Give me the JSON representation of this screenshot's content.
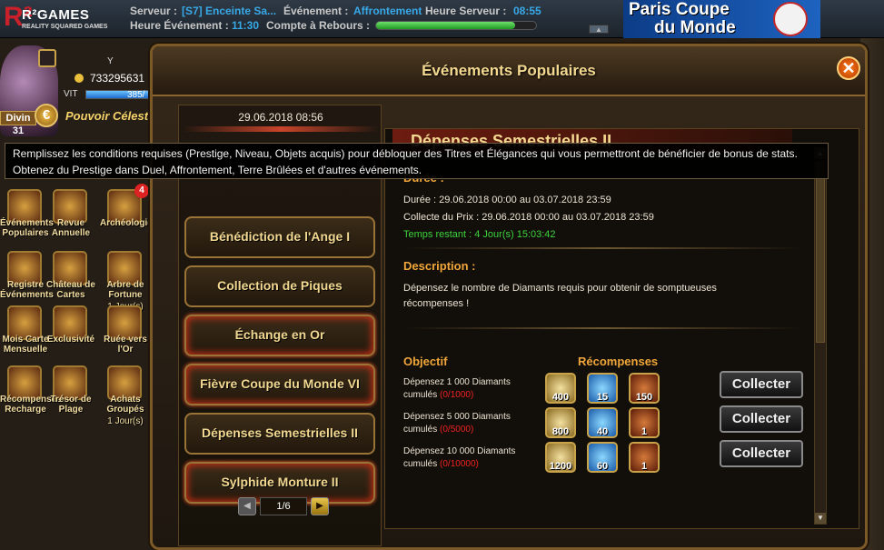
{
  "topbar": {
    "logo": {
      "mark": "R²",
      "name": "R²GAMES",
      "tagline": "REALITY SQUARED GAMES"
    },
    "server_label": "Serveur :",
    "server_value": "[S7] Enceinte Sa...",
    "event_label": "Événement :",
    "event_value": "Affrontement",
    "server_time_label": "Heure Serveur :",
    "server_time_value": "08:55",
    "event_time_label": "Heure Événement :",
    "event_time_value": "11:30",
    "countdown_label": "Compte à Rebours :",
    "countdown_progress": 0.87,
    "collapse_icon": "up-arrow-icon",
    "banner_line1": "Paris Coupe",
    "banner_line2": "du Monde"
  },
  "player": {
    "name": "Y",
    "gold": "733295631",
    "vit_label": "VIT",
    "vit_value": "385/",
    "vit_fill": 0.96,
    "rank_label": "Divin 31",
    "rank_icon_text": "€",
    "title": "Pouvoir Céleste"
  },
  "side_icons": [
    {
      "label": "Événements Populaires",
      "icon": "events-icon"
    },
    {
      "label": "Revue Annuelle",
      "icon": "annual-review-icon"
    },
    {
      "label": "Archéologie",
      "icon": "archeology-icon",
      "badge": "4"
    },
    {
      "label": "Registre Événements",
      "icon": "registry-icon"
    },
    {
      "label": "Château de Cartes",
      "icon": "card-castle-icon"
    },
    {
      "label": "Arbre de Fortune",
      "icon": "fortune-tree-icon",
      "note": "1 Jour(s)"
    },
    {
      "label": "Mois Carte Mensuelle",
      "icon": "monthly-card-icon"
    },
    {
      "label": "Exclusivité",
      "icon": "exclusive-icon"
    },
    {
      "label": "Ruée vers l'Or",
      "icon": "gold-rush-icon"
    },
    {
      "label": "Récompenses Recharge",
      "icon": "recharge-rewards-icon"
    },
    {
      "label": "Trésor de Plage",
      "icon": "beach-treasure-icon"
    },
    {
      "label": "Achats Groupés",
      "icon": "group-buy-icon",
      "note": "1 Jour(s)"
    }
  ],
  "modal": {
    "title": "Événements Populaires",
    "close_icon": "close-icon",
    "left": {
      "date": "29.06.2018 08:56",
      "events": [
        "Bénédiction de l'Ange I",
        "Collection de Piques",
        "Échange en Or",
        "Fièvre Coupe du Monde VI",
        "Dépenses Semestrielles II",
        "Sylphide Monture II"
      ],
      "pager": {
        "label": "1/6"
      }
    },
    "right": {
      "title": "Dépenses Semestrielles II",
      "duration_heading": "Durée :",
      "duration_line": "Durée : 29.06.2018 00:00 au 03.07.2018 23:59",
      "collect_line": "Collecte du Prix : 29.06.2018 00:00 au 03.07.2018 23:59",
      "remaining_line": "Temps restant : 4 Jour(s)  15:03:42",
      "description_heading": "Description :",
      "description_line1": "Dépensez le nombre de Diamants requis pour obtenir de somptueuses",
      "description_line2": "récompenses !",
      "objective_heading": "Objectif",
      "rewards_heading": "Récompenses",
      "rewards": [
        {
          "objective": "Dépensez 1 000 Diamants cumulés",
          "progress": "(0/1000)",
          "items": [
            "400",
            "15",
            "150"
          ],
          "button": "Collecter"
        },
        {
          "objective": "Dépensez 5 000 Diamants cumulés",
          "progress": "(0/5000)",
          "items": [
            "800",
            "40",
            "1"
          ],
          "button": "Collecter"
        },
        {
          "objective": "Dépensez 10 000 Diamants cumulés",
          "progress": "(0/10000)",
          "items": [
            "1200",
            "60",
            "1"
          ],
          "button": "Collecter"
        }
      ]
    }
  },
  "tooltip": {
    "line1": "Remplissez les conditions requises (Prestige, Niveau, Objets acquis) pour débloquer des Titres et Élégances qui vous permettront de bénéficier de bonus de stats.",
    "line2": "Obtenez du Prestige dans Duel, Affrontement, Terre Brûlées et d'autres événements."
  }
}
